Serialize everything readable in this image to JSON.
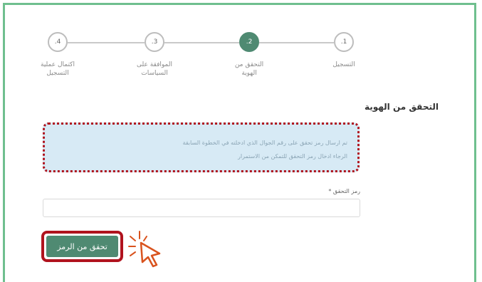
{
  "stepper": {
    "steps": [
      {
        "number": ".1",
        "label": "التسجيل",
        "active": false
      },
      {
        "number": ".2",
        "label_line1": "التحقق من",
        "label_line2": "الهوية",
        "active": true
      },
      {
        "number": ".3",
        "label_line1": "الموافقة على",
        "label_line2": "السياسات",
        "active": false
      },
      {
        "number": ".4",
        "label_line1": "اكتمال عملية",
        "label_line2": "التسجيل",
        "active": false
      }
    ]
  },
  "section": {
    "title": "التحقق من الهوية"
  },
  "info": {
    "line1": "تم ارسال رمز تحقق على رقم الجوال الذي ادخلته في الخطوة السابقة",
    "line2": "الرجاء ادخال رمز التحقق للتمكن من الاستمرار"
  },
  "form": {
    "code_label": "رمز التحقق *",
    "code_value": "",
    "verify_button": "تحقق من الرمز"
  },
  "colors": {
    "accent": "#4f8a72",
    "frame_border": "#6fbf8e",
    "highlight": "#b0131e",
    "info_bg": "#d7eaf5",
    "cursor": "#d9531e"
  },
  "icons": {
    "cursor": "click-cursor-icon"
  }
}
